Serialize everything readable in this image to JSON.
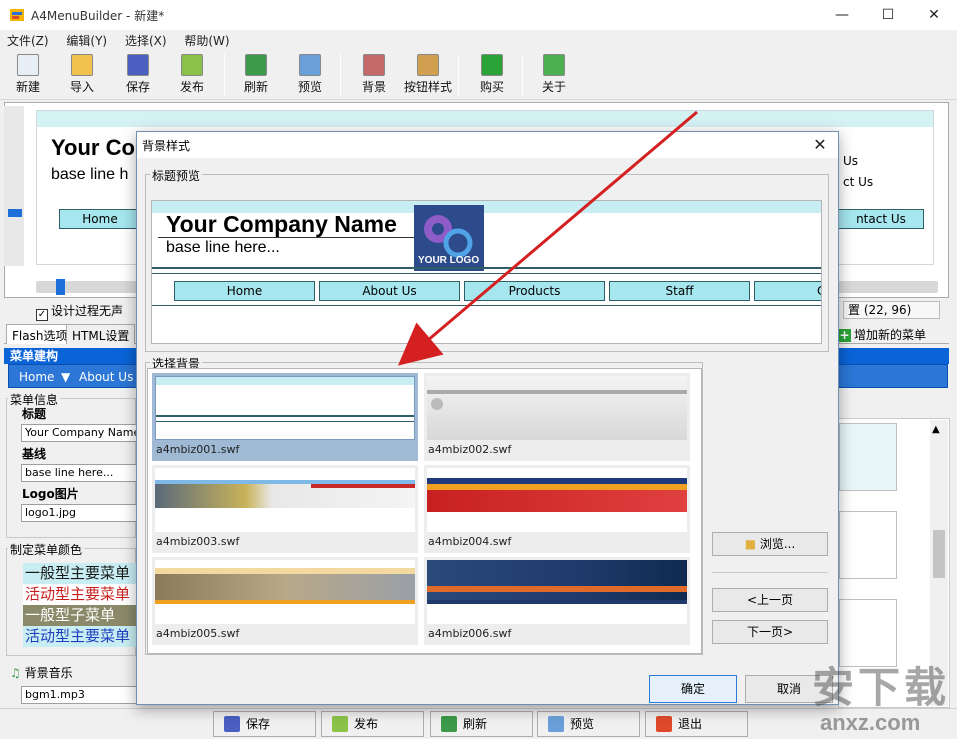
{
  "window": {
    "title": "A4MenuBuilder - 新建*",
    "minimize": "—",
    "maximize": "☐",
    "close": "✕"
  },
  "menubar": [
    "文件(Z)",
    "编辑(Y)",
    "选择(X)",
    "帮助(W)"
  ],
  "toolbar": [
    {
      "label": "新建",
      "icon": "new-file-icon",
      "color": "#e8eef5"
    },
    {
      "label": "导入",
      "icon": "open-folder-icon",
      "color": "#f2c14e"
    },
    {
      "label": "保存",
      "icon": "save-disk-icon",
      "color": "#4a5fbf"
    },
    {
      "label": "发布",
      "icon": "publish-icon",
      "color": "#8bc34a"
    },
    {
      "label": "刷新",
      "icon": "refresh-icon",
      "color": "#3c9a4a"
    },
    {
      "label": "预览",
      "icon": "preview-magnifier-icon",
      "color": "#6aa0d8"
    },
    {
      "label": "背景",
      "icon": "background-icon",
      "color": "#c46a6a"
    },
    {
      "label": "按钮样式",
      "icon": "button-style-icon",
      "color": "#d0a050"
    },
    {
      "label": "购买",
      "icon": "cart-icon",
      "color": "#2aa436"
    },
    {
      "label": "关于",
      "icon": "info-icon",
      "color": "#4caf50"
    }
  ],
  "editor": {
    "company": "Your Co",
    "baseline": "base line h",
    "nav_home": "Home",
    "right_us": "Us",
    "right_ct": "ct Us",
    "right_contact": "ntact Us",
    "checkbox_label": "设计过程无声",
    "coords": "置 (22, 96)"
  },
  "tabs": [
    "Flash选项",
    "HTML设置"
  ],
  "add_menu": "增加新的菜单",
  "menu_build": {
    "header": "菜单建构",
    "item1": "Home",
    "item2": "About Us"
  },
  "menu_info": {
    "group_title": "菜单信息",
    "title_label": "标题",
    "title_value": "Your Company Name",
    "baseline_label": "基线",
    "baseline_value": "base line here...",
    "logo_label": "Logo图片",
    "logo_value": "logo1.jpg"
  },
  "menu_colors": {
    "group_title": "制定菜单颜色",
    "rows": [
      {
        "text": "一般型主要菜单",
        "fg": "#1a1a1a",
        "bg": "#c8eef3"
      },
      {
        "text": "活动型主要菜单",
        "fg": "#c81e1e",
        "bg": "#ffffff"
      },
      {
        "text": "一般型子菜单",
        "fg": "#ffffff",
        "bg": "#8a8a6a"
      },
      {
        "text": "活动型主要菜单",
        "fg": "#1f3fbf",
        "bg": "#c8eef3"
      }
    ]
  },
  "music": {
    "label": "背景音乐",
    "value": "bgm1.mp3"
  },
  "bottom_buttons": [
    {
      "label": "保存",
      "icon": "save-disk-icon",
      "color": "#4a5fbf"
    },
    {
      "label": "发布",
      "icon": "publish-icon",
      "color": "#8bc34a"
    },
    {
      "label": "刷新",
      "icon": "refresh-icon",
      "color": "#3c9a4a"
    },
    {
      "label": "预览",
      "icon": "preview-magnifier-icon",
      "color": "#6aa0d8"
    },
    {
      "label": "退出",
      "icon": "exit-icon",
      "color": "#e04a2a"
    }
  ],
  "dialog": {
    "title": "背景样式",
    "close": "✕",
    "preview_legend": "标题预览",
    "preview": {
      "company": "Your Company Name",
      "baseline": "base line here...",
      "logo_text": "YOUR LOGO",
      "nav": [
        "Home",
        "About Us",
        "Products",
        "Staff",
        "Cli"
      ]
    },
    "select_legend": "选择背景",
    "backgrounds": [
      {
        "name": "a4mbiz001.swf",
        "selected": true
      },
      {
        "name": "a4mbiz002.swf",
        "selected": false
      },
      {
        "name": "a4mbiz003.swf",
        "selected": false
      },
      {
        "name": "a4mbiz004.swf",
        "selected": false
      },
      {
        "name": "a4mbiz005.swf",
        "selected": false
      },
      {
        "name": "a4mbiz006.swf",
        "selected": false
      }
    ],
    "browse": "浏览...",
    "prev_page": "<上一页",
    "next_page": "下一页>",
    "ok": "确定",
    "cancel": "取消"
  },
  "watermark": {
    "cn": "安下载",
    "en": "anxz.com"
  },
  "colors": {
    "accent_blue": "#0a64d8",
    "nav_cyan": "#a6e6ee",
    "arrow_red": "#d42020"
  }
}
